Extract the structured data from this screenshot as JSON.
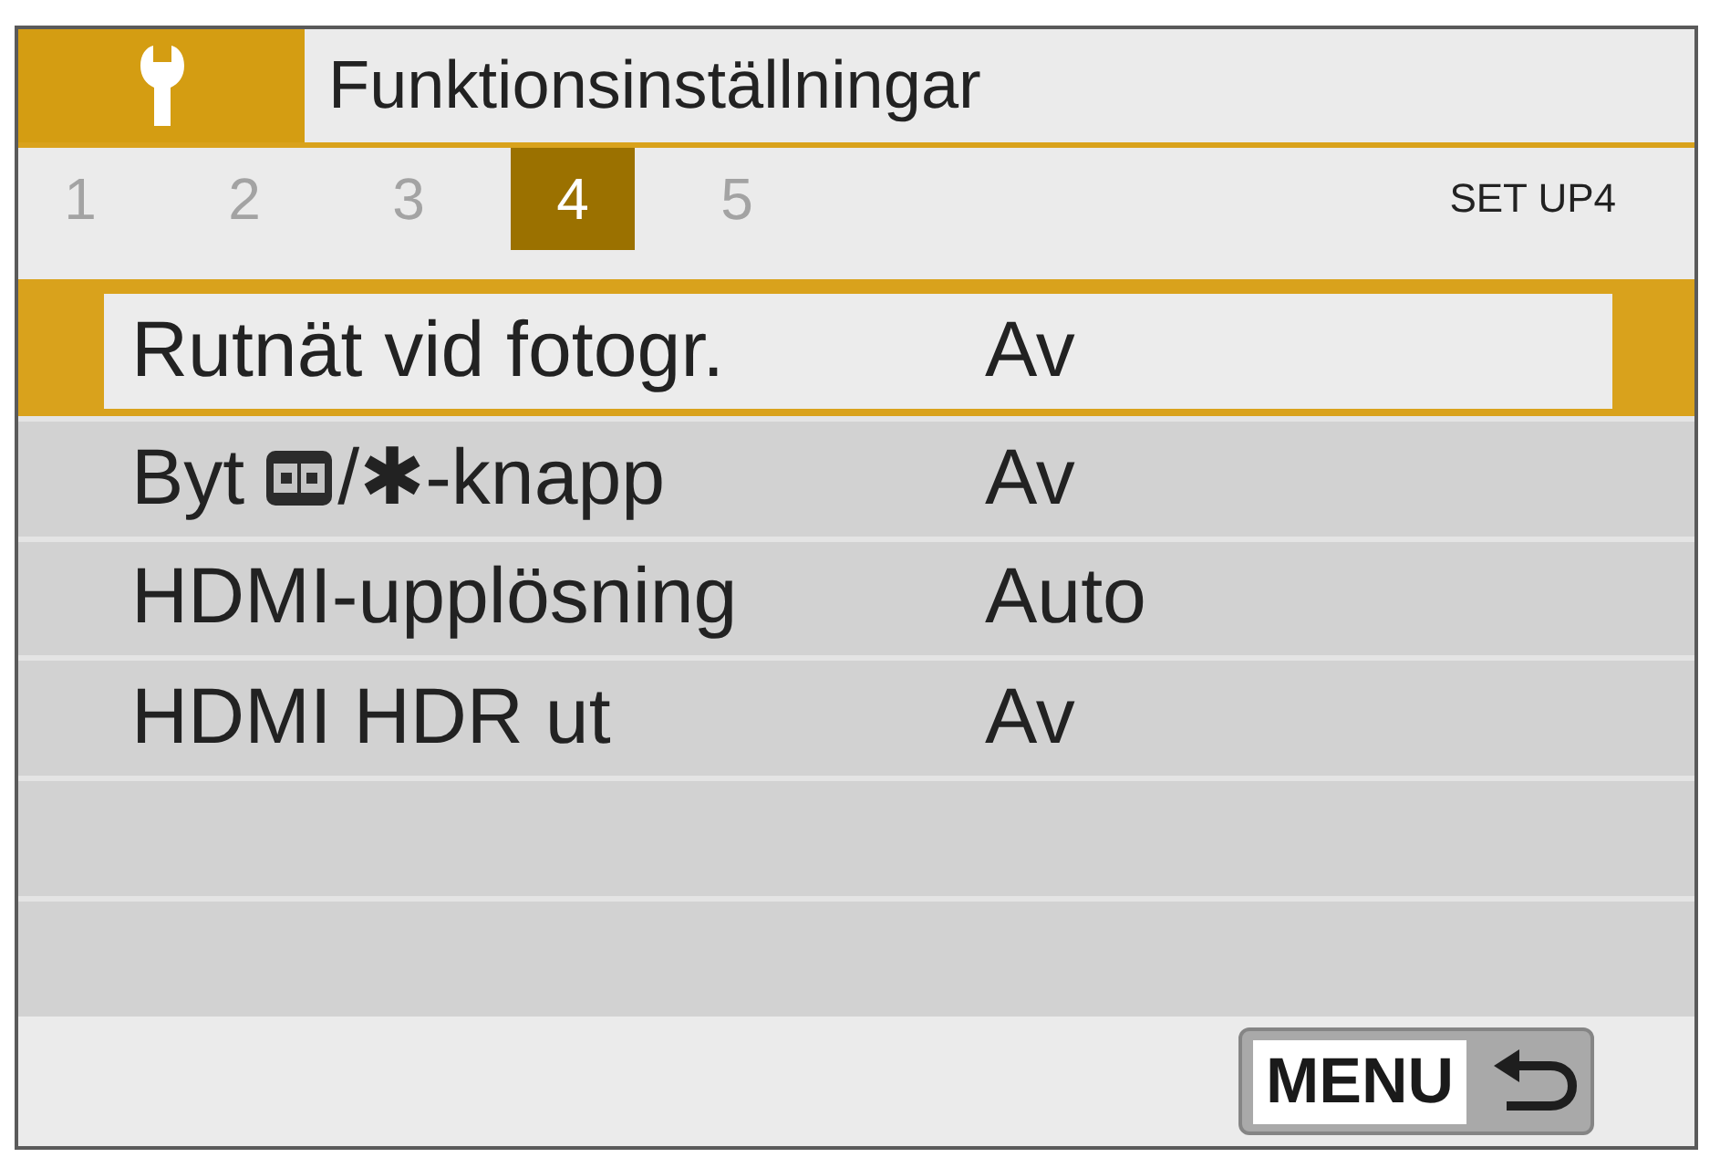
{
  "header": {
    "title": "Funktionsinställningar"
  },
  "tabs": [
    {
      "label": "1",
      "selected": false
    },
    {
      "label": "2",
      "selected": false
    },
    {
      "label": "3",
      "selected": false
    },
    {
      "label": "4",
      "selected": true
    },
    {
      "label": "5",
      "selected": false
    }
  ],
  "page_label": "SET UP4",
  "menu_items": [
    {
      "label_parts": [
        {
          "kind": "text",
          "text": "Rutnät vid fotogr."
        }
      ],
      "value": "Av",
      "selected": true
    },
    {
      "label_parts": [
        {
          "kind": "text",
          "text": "Byt"
        },
        {
          "kind": "icon"
        },
        {
          "kind": "text",
          "text": "/✱-knapp"
        }
      ],
      "value": "Av",
      "selected": false
    },
    {
      "label_parts": [
        {
          "kind": "text",
          "text": "HDMI-upplösning"
        }
      ],
      "value": "Auto",
      "selected": false
    },
    {
      "label_parts": [
        {
          "kind": "text",
          "text": "HDMI HDR ut"
        }
      ],
      "value": "Av",
      "selected": false
    }
  ],
  "footer": {
    "menu_button": {
      "label": "MENU"
    }
  }
}
